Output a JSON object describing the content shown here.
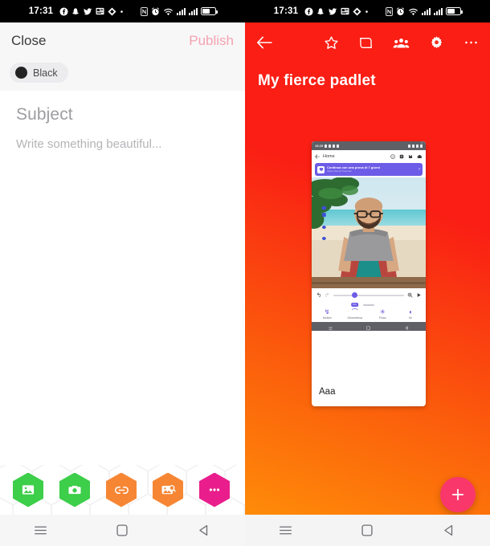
{
  "status_bar": {
    "time": "17:31",
    "icons": [
      "facebook-icon",
      "snapchat-icon",
      "twitter-icon",
      "news-icon",
      "diamond-icon",
      "dot-icon",
      "nfc-icon",
      "alarm-icon",
      "wifi-icon",
      "signal-icon-1",
      "signal-icon-2",
      "battery-icon"
    ]
  },
  "composer": {
    "close_label": "Close",
    "publish_label": "Publish",
    "color": {
      "name": "Black",
      "hex": "#232323"
    },
    "subject_placeholder": "Subject",
    "body_placeholder": "Write something beautiful...",
    "attachments": [
      {
        "name": "gallery",
        "icon": "image-icon",
        "color": "#3dce4a"
      },
      {
        "name": "camera",
        "icon": "camera-icon",
        "color": "#3dce4a"
      },
      {
        "name": "link",
        "icon": "link-icon",
        "color": "#f68634"
      },
      {
        "name": "image-search",
        "icon": "image-search-icon",
        "color": "#f68634"
      },
      {
        "name": "more",
        "icon": "ellipsis-icon",
        "color": "#e91e8c"
      }
    ]
  },
  "board": {
    "title": "My fierce padlet",
    "back_label": "back-arrow",
    "actions": [
      "favorite-star",
      "remake-icon",
      "share-people-icon",
      "settings-gear-icon",
      "overflow-menu-icon"
    ],
    "gradient_from": "#fa1e14",
    "gradient_to": "#ff9408",
    "fab_label": "+",
    "fab_color": "#f9376b",
    "post": {
      "caption": "Aaa",
      "nested_screenshot": {
        "status_time": "15:25",
        "app_title": "Home",
        "banner_title": "Continua con una prova di 7 giorni",
        "banner_subtitle": "Ottieni Story2 Premium",
        "tools": [
          "undo-icon",
          "redo-icon",
          "zoom-icon",
          "play-icon"
        ],
        "tabs": [
          {
            "label": "Motion",
            "glyph": "↯",
            "badge": ""
          },
          {
            "label": "Geometrica",
            "glyph": "⌒",
            "badge": "Pro"
          },
          {
            "label": "Floss",
            "glyph": "✳",
            "badge": ""
          },
          {
            "label": "Ve",
            "glyph": "◖",
            "badge": ""
          }
        ]
      }
    }
  },
  "navbar": {
    "items": [
      "recents-icon",
      "home-icon",
      "back-icon"
    ]
  }
}
